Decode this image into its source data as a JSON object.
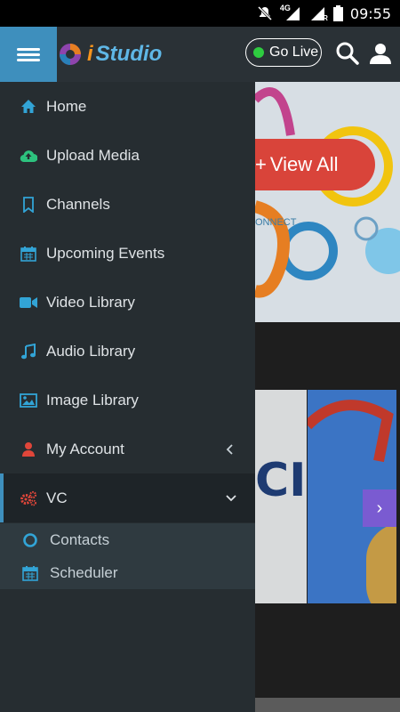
{
  "status_bar": {
    "time": "09:55",
    "network": "4G",
    "roaming": "R"
  },
  "header": {
    "logo_prefix": "i",
    "logo_text": "Studio",
    "go_live_label": "Go Live"
  },
  "drawer": {
    "items": [
      {
        "label": "Home",
        "icon": "home-icon"
      },
      {
        "label": "Upload Media",
        "icon": "cloud-upload-icon"
      },
      {
        "label": "Channels",
        "icon": "bookmark-icon"
      },
      {
        "label": "Upcoming Events",
        "icon": "calendar-icon"
      },
      {
        "label": "Video Library",
        "icon": "video-camera-icon"
      },
      {
        "label": "Audio Library",
        "icon": "music-note-icon"
      },
      {
        "label": "Image Library",
        "icon": "image-icon"
      },
      {
        "label": "My Account",
        "icon": "user-icon"
      },
      {
        "label": "VC",
        "icon": "cogs-icon"
      }
    ],
    "submenu": [
      {
        "label": "Contacts",
        "icon": "circle-icon"
      },
      {
        "label": "Scheduler",
        "icon": "calendar-icon"
      }
    ]
  },
  "background": {
    "banner_button": "View All",
    "banner_caption": "ONNECT",
    "thumb_text": "CI"
  },
  "colors": {
    "accent": "#3e8fbd",
    "drawer_bg": "#262d31",
    "header_bg": "#2a3136",
    "live_dot": "#2ecc40",
    "view_all": "#d9443a",
    "next_button": "#7a5bd1"
  }
}
